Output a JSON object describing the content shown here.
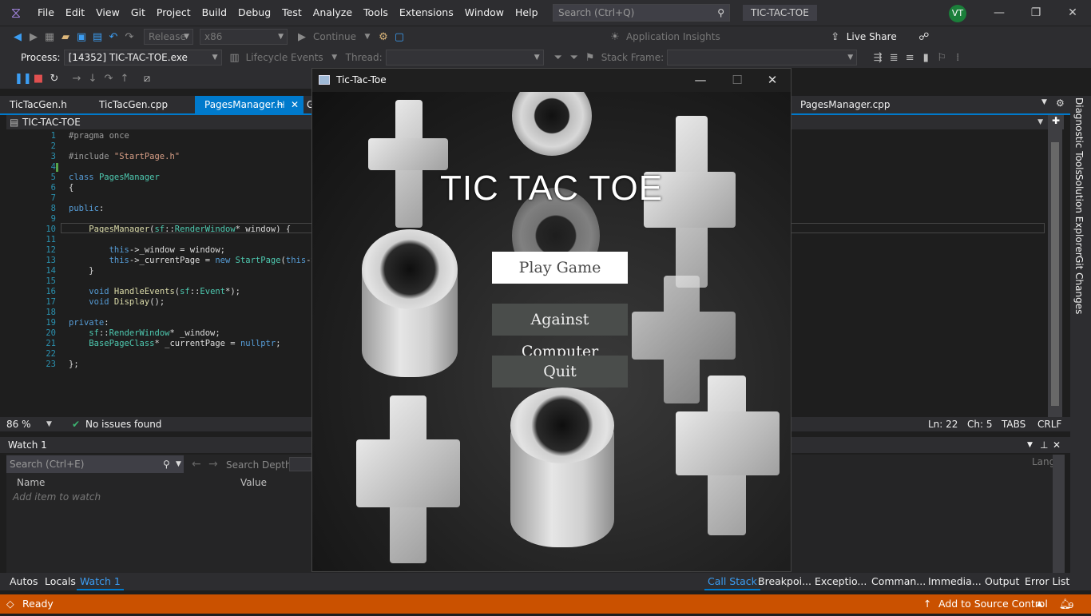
{
  "menubar": {
    "items": [
      "File",
      "Edit",
      "View",
      "Git",
      "Project",
      "Build",
      "Debug",
      "Test",
      "Analyze",
      "Tools",
      "Extensions",
      "Window",
      "Help"
    ],
    "search_placeholder": "Search (Ctrl+Q)",
    "solution_name": "TIC-TAC-TOE",
    "avatar_initials": "VT"
  },
  "toolbar": {
    "config": "Release",
    "platform": "x86",
    "continue_label": "Continue",
    "app_insights": "Application Insights",
    "live_share": "Live Share",
    "process_label": "Process:",
    "process_value": "[14352] TIC-TAC-TOE.exe",
    "lifecycle": "Lifecycle Events",
    "thread_label": "Thread:",
    "stack_frame_label": "Stack Frame:"
  },
  "doc_tabs": {
    "tab1": "TicTacGen.h",
    "tab2": "TicTacGen.cpp",
    "tab3": "PagesManager.h",
    "tab4": "PagesManager.cpp",
    "hidden_tab_fragment": "G"
  },
  "editor": {
    "nav_scope": "TIC-TAC-TOE",
    "zoom": "86 %",
    "issues": "No issues found",
    "line": "Ln: 22",
    "col": "Ch: 5",
    "tabs": "TABS",
    "eol": "CRLF",
    "lines": [
      "1",
      "2",
      "3",
      "4",
      "5",
      "6",
      "7",
      "8",
      "9",
      "10",
      "11",
      "12",
      "13",
      "14",
      "15",
      "16",
      "17",
      "18",
      "19",
      "20",
      "21",
      "22",
      "23"
    ]
  },
  "watch": {
    "title": "Watch 1",
    "search_placeholder": "Search (Ctrl+E)",
    "search_depth": "Search Depth:",
    "col_name": "Name",
    "col_value": "Value",
    "col_lang": "Lang",
    "add_item": "Add item to watch"
  },
  "bottom_tabs": {
    "autos": "Autos",
    "locals": "Locals",
    "watch1": "Watch 1",
    "call_stack": "Call Stack",
    "breakpoints": "Breakpoi...",
    "exceptions": "Exceptio...",
    "command": "Comman...",
    "immediate": "Immedia...",
    "output": "Output",
    "errors": "Error List"
  },
  "statusbar": {
    "status": "Ready",
    "source_control": "Add to Source Control",
    "notifications": "9"
  },
  "right_rail": {
    "diag": "Diagnostic Tools",
    "sol": "Solution Explorer",
    "git": "Git Changes"
  },
  "game": {
    "window_title": "Tic-Tac-Toe",
    "heading": "TIC TAC TOE",
    "play": "Play Game",
    "against_computer": "Against Computer",
    "quit": "Quit"
  }
}
